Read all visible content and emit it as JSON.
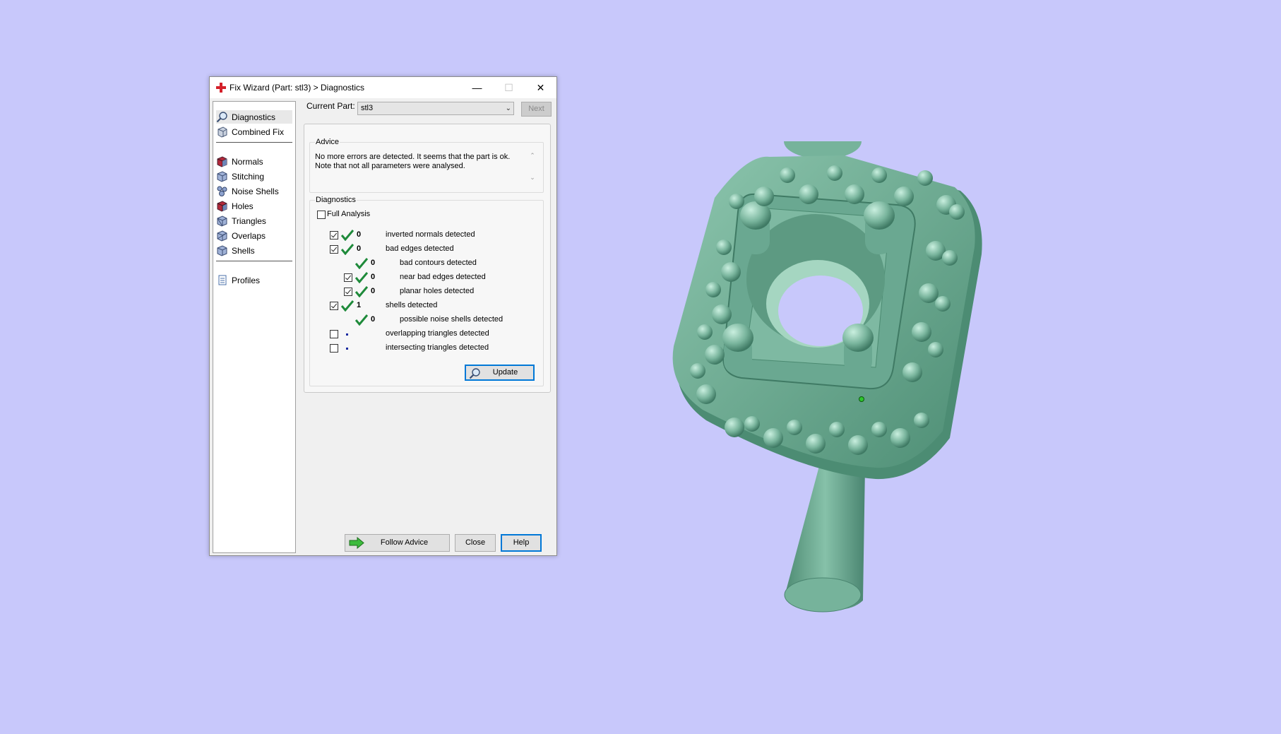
{
  "window": {
    "title": "Fix Wizard (Part: stl3) > Diagnostics",
    "min_label": "—",
    "max_label": "☐",
    "close_label": "✕"
  },
  "nav": {
    "items": [
      {
        "label": "Diagnostics",
        "icon": "magnifier-icon"
      },
      {
        "label": "Combined Fix",
        "icon": "combined-fix-icon"
      },
      {
        "label": "Normals",
        "icon": "normals-cube-icon"
      },
      {
        "label": "Stitching",
        "icon": "stitching-cube-icon"
      },
      {
        "label": "Noise Shells",
        "icon": "noise-shells-icon"
      },
      {
        "label": "Holes",
        "icon": "holes-cube-icon"
      },
      {
        "label": "Triangles",
        "icon": "triangles-cube-icon"
      },
      {
        "label": "Overlaps",
        "icon": "overlaps-cube-icon"
      },
      {
        "label": "Shells",
        "icon": "shells-cube-icon"
      },
      {
        "label": "Profiles",
        "icon": "profiles-icon"
      }
    ]
  },
  "current_part": {
    "label": "Current Part:",
    "value": "stl3",
    "next_label": "Next"
  },
  "advice": {
    "title": "Advice",
    "line1": "No more errors are detected. It seems that the part is ok.",
    "line2": "Note that not all parameters were analysed."
  },
  "diagnostics": {
    "title": "Diagnostics",
    "full_analysis_label": "Full Analysis",
    "rows": [
      {
        "count": "0",
        "text": "inverted normals detected"
      },
      {
        "count": "0",
        "text": "bad edges detected"
      },
      {
        "count": "0",
        "text": "bad contours detected"
      },
      {
        "count": "0",
        "text": "near bad edges detected"
      },
      {
        "count": "0",
        "text": "planar holes detected"
      },
      {
        "count": "1",
        "text": "shells detected"
      },
      {
        "count": "0",
        "text": "possible noise shells detected"
      },
      {
        "count": "",
        "text": "overlapping triangles detected"
      },
      {
        "count": "",
        "text": "intersecting triangles detected"
      }
    ],
    "update_label": "Update"
  },
  "footer": {
    "follow_advice_label": "Follow Advice",
    "close_label": "Close",
    "help_label": "Help"
  },
  "colors": {
    "background": "#c8c8fb",
    "model": "#6fae96",
    "check_green": "#1e8a3a"
  }
}
